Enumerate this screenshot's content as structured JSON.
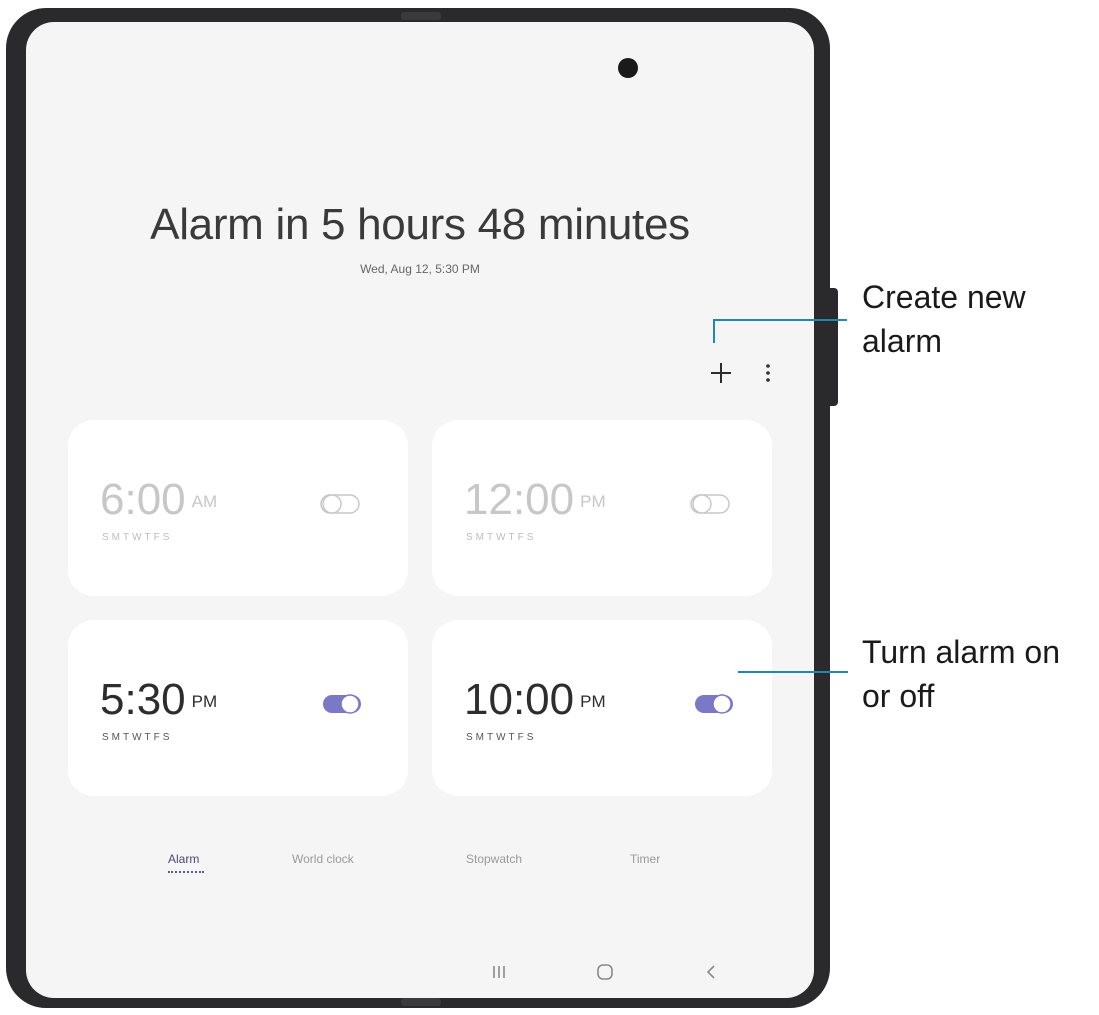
{
  "alarm_summary": {
    "headline": "Alarm in 5 hours 48 minutes",
    "next_alarm": "Wed, Aug 12, 5:30 PM"
  },
  "toolbar": {
    "add_icon": "plus-icon",
    "more_icon": "more-vert-icon"
  },
  "alarms": [
    {
      "time": "6:00",
      "ampm": "AM",
      "days": "SMTWTFS",
      "enabled": false
    },
    {
      "time": "12:00",
      "ampm": "PM",
      "days": "SMTWTFS",
      "enabled": false
    },
    {
      "time": "5:30",
      "ampm": "PM",
      "days": "SMTWTFS",
      "enabled": true
    },
    {
      "time": "10:00",
      "ampm": "PM",
      "days": "SMTWTFS",
      "enabled": true
    }
  ],
  "tabs": [
    {
      "label": "Alarm",
      "selected": true
    },
    {
      "label": "World clock",
      "selected": false
    },
    {
      "label": "Stopwatch",
      "selected": false
    },
    {
      "label": "Timer",
      "selected": false
    }
  ],
  "nav_keys": [
    "recents-icon",
    "home-icon",
    "back-icon"
  ],
  "callouts": {
    "create": "Create new alarm",
    "toggle": "Turn alarm on or off"
  },
  "colors": {
    "toggle_on": "#7b78c8",
    "callout_line": "#1e8ab2"
  }
}
